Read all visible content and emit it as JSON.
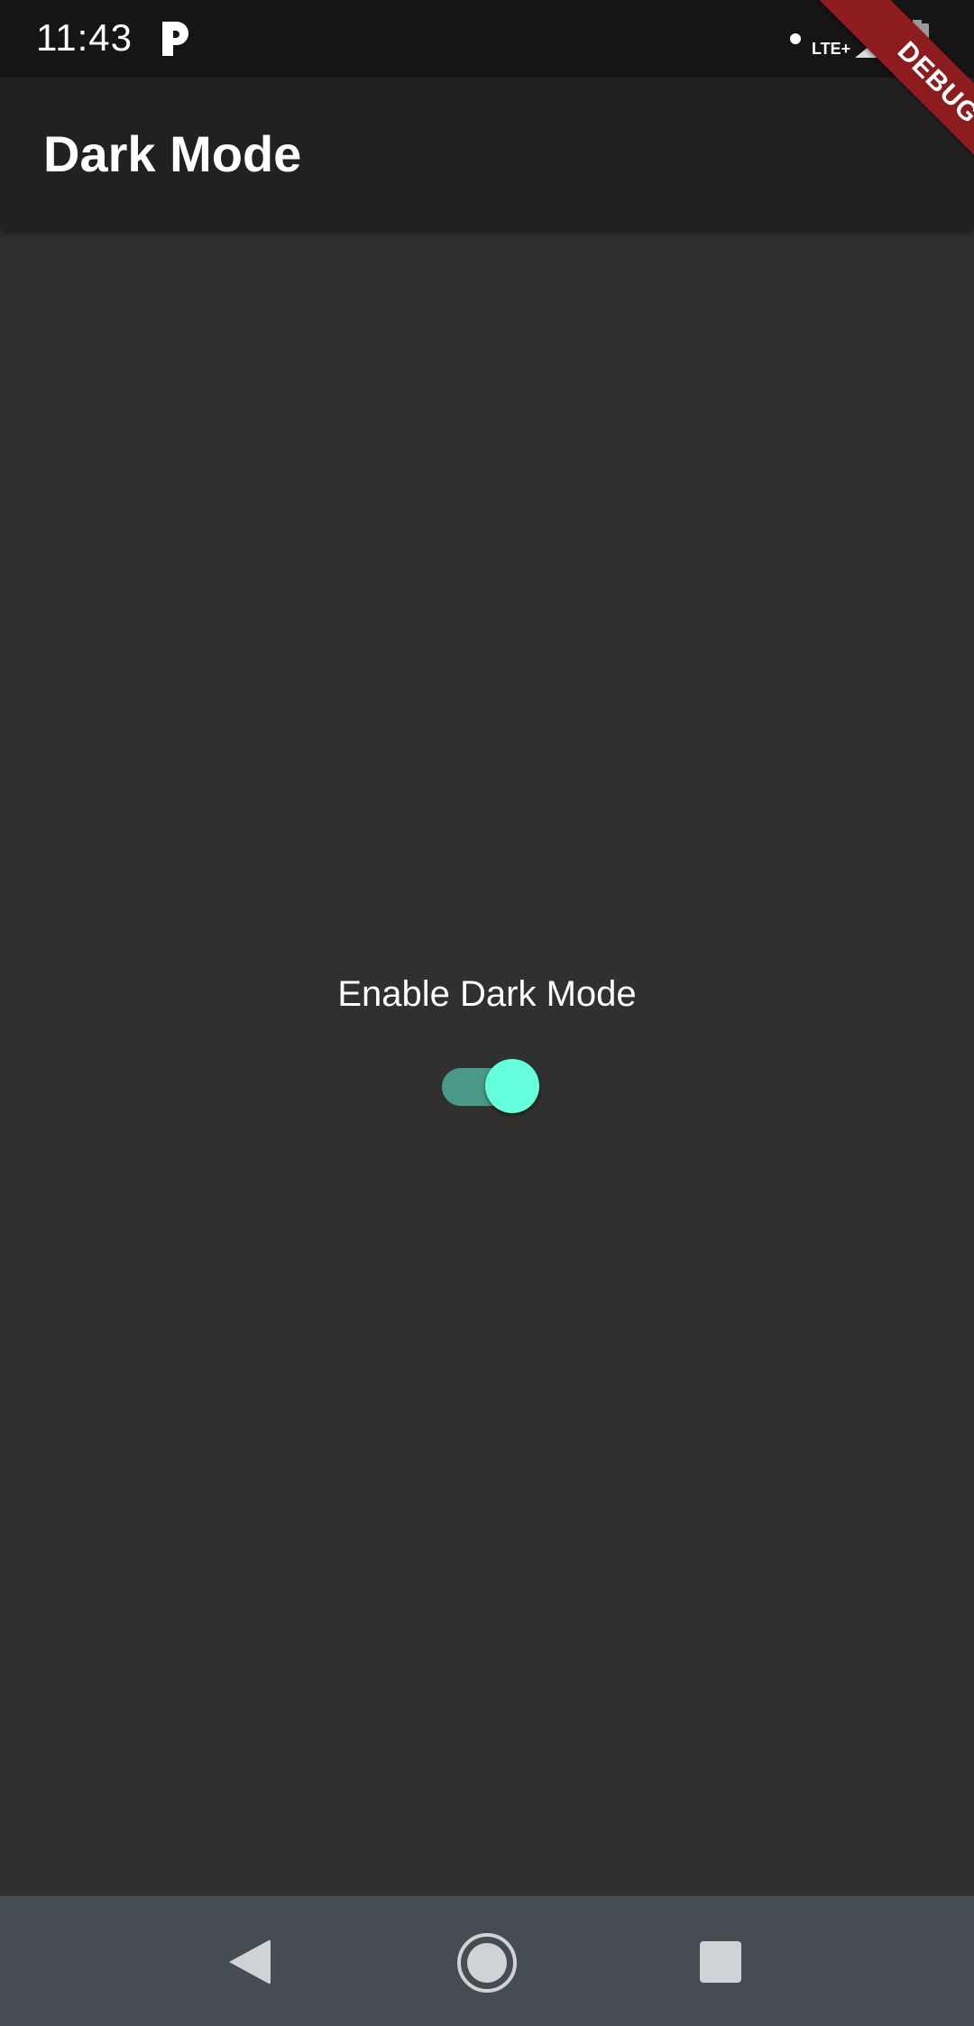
{
  "status_bar": {
    "time": "11:43",
    "network": "LTE+",
    "icons": [
      "pandora-icon",
      "notification-dot-icon",
      "signal-icon",
      "battery-charging-icon"
    ]
  },
  "app_bar": {
    "title": "Dark Mode"
  },
  "debug_banner": {
    "label": "DEBUG"
  },
  "content": {
    "label": "Enable Dark Mode",
    "dark_mode_switch": {
      "checked": true,
      "active_track_color": "#4a9987",
      "active_thumb_color": "#64ffda"
    }
  },
  "nav_bar": {
    "icons": [
      "back-icon",
      "home-icon",
      "recents-icon"
    ]
  },
  "colors": {
    "background": "#303030",
    "app_bar": "#212121",
    "status_bar": "#151515",
    "nav_bar": "#454d53",
    "debug_banner": "#8d1c1e",
    "accent": "#64ffda"
  }
}
